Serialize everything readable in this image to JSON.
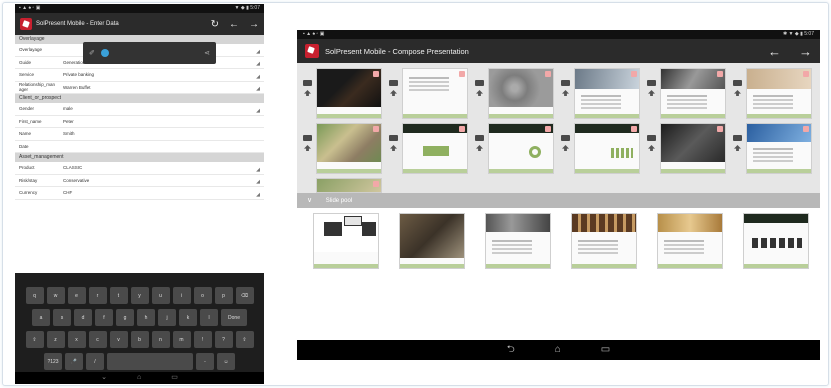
{
  "left_panel": {
    "status_bar": {
      "left": "▪ ▲ ♠ ▫ ▣",
      "right": "▼ ◆ ▮ 5:07"
    },
    "app_title": "SolPresent Mobile - Enter Data",
    "sections": [
      {
        "title": "Overlayage",
        "rows": [
          {
            "label": "Overlayage",
            "value": ""
          },
          {
            "label": "Guide",
            "value": "Generation"
          },
          {
            "label": "Service",
            "value": "Private banking"
          },
          {
            "label": "Relationship_man ager",
            "value": "Warren Buffet"
          }
        ]
      },
      {
        "title": "Client_or_prospect",
        "rows": [
          {
            "label": "Gender",
            "value": "male"
          },
          {
            "label": "First_name",
            "value": "Peter"
          },
          {
            "label": "Name",
            "value": "Smith"
          },
          {
            "label": "Date",
            "value": ""
          }
        ]
      },
      {
        "title": "Asset_management",
        "rows": [
          {
            "label": "Product",
            "value": "CLASSIC"
          },
          {
            "label": "Risk/stay",
            "value": "Conservative"
          },
          {
            "label": "Currency",
            "value": "CHF"
          }
        ]
      }
    ],
    "keyboard": {
      "row1": [
        "q",
        "w",
        "e",
        "r",
        "t",
        "y",
        "u",
        "i",
        "o",
        "p",
        "⌫"
      ],
      "row2": [
        "a",
        "s",
        "d",
        "f",
        "g",
        "h",
        "j",
        "k",
        "l",
        "Done"
      ],
      "row3": [
        "⇧",
        "z",
        "x",
        "c",
        "v",
        "b",
        "n",
        "m",
        "!",
        "?",
        "⇧"
      ],
      "row4": [
        "?123",
        "🎤",
        "/",
        "",
        "",
        "",
        "",
        "",
        "",
        "-",
        "☺"
      ]
    }
  },
  "right_panel": {
    "status_bar": {
      "left": "▪ ▲ ♠ ▫ ▣",
      "right": "✱ ▼ ◆ ▮ 5:07"
    },
    "app_title": "SolPresent Mobile - Compose Presentation",
    "slide_pool_label": "Slide pool"
  },
  "colors": {
    "accent": "#9cbd6e",
    "appbar": "#2b2b2b",
    "logo": "#c8202f"
  }
}
